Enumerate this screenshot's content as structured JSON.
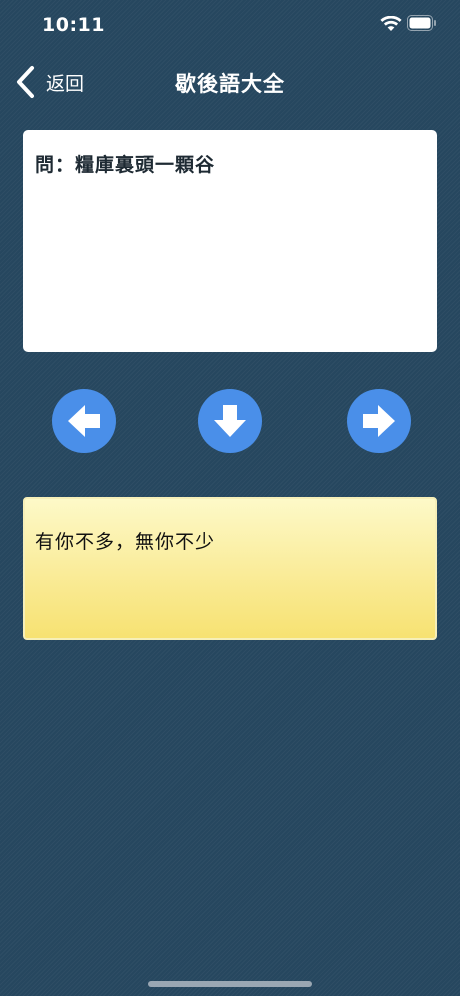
{
  "status_bar": {
    "time": "10:11",
    "wifi_icon": "wifi-icon",
    "battery_icon": "battery-icon"
  },
  "nav": {
    "back_label": "返回",
    "back_icon": "chevron-left-icon",
    "title": "歇後語大全"
  },
  "question": {
    "text": "問：糧庫裏頭一顆谷"
  },
  "controls": {
    "prev_icon": "arrow-left-icon",
    "reveal_icon": "arrow-down-icon",
    "next_icon": "arrow-right-icon",
    "button_color": "#4a8fe9"
  },
  "answer": {
    "text": "有你不多，無你不少"
  },
  "colors": {
    "background": "#26475f",
    "answer_card_top": "#fdf9c8",
    "answer_card_bottom": "#f7e272"
  }
}
